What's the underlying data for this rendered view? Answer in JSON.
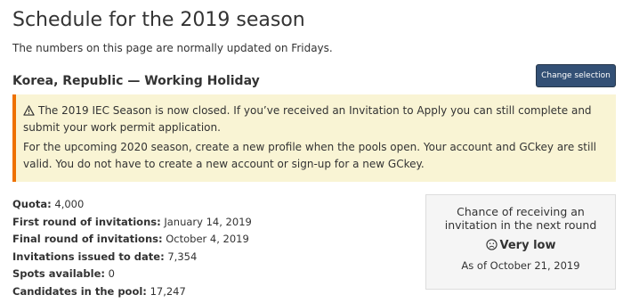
{
  "page": {
    "title": "Schedule for the 2019 season",
    "subtitle": "The numbers on this page are normally updated on Fridays."
  },
  "selection": {
    "heading": "Korea, Republic — Working Holiday",
    "change_button": "Change selection"
  },
  "alert": {
    "icon": "warning-icon",
    "line1": "The 2019 IEC Season is now closed. If you’ve received an Invitation to Apply you can still complete and submit your work permit application.",
    "line2": "For the upcoming 2020 season, create a new profile when the pools open. Your account and GCkey are still valid. You do not have to create a new account or sign-up for a new GCkey.",
    "accent_color": "#ee7100",
    "background_color": "#f9f4d4"
  },
  "stats": [
    {
      "label": "Quota:",
      "value": "4,000"
    },
    {
      "label": "First round of invitations:",
      "value": "January 14, 2019"
    },
    {
      "label": "Final round of invitations:",
      "value": "October 4, 2019"
    },
    {
      "label": "Invitations issued to date:",
      "value": "7,354"
    },
    {
      "label": "Spots available:",
      "value": "0"
    },
    {
      "label": "Candidates in the pool:",
      "value": "17,247"
    }
  ],
  "chance": {
    "title": "Chance of receiving an invitation in the next round",
    "icon": "sad-face-icon",
    "value": "Very low",
    "as_of": "As of October 21, 2019"
  },
  "colors": {
    "button_bg": "#335075",
    "text": "#333333"
  }
}
